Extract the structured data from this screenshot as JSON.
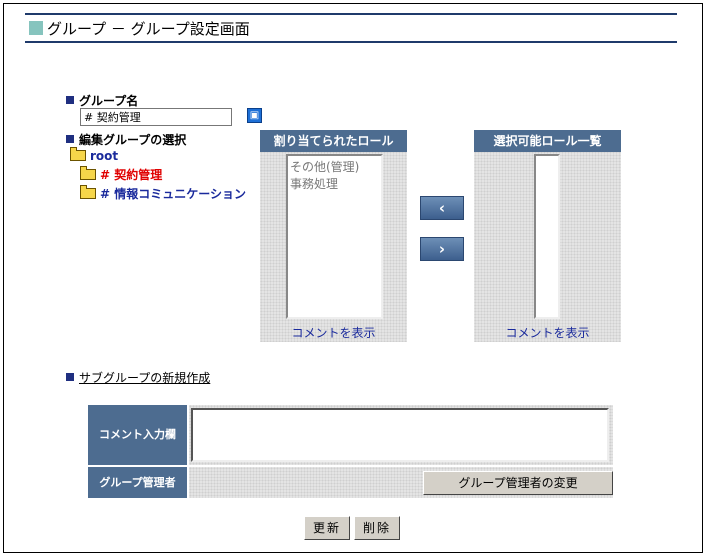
{
  "header": {
    "title": "グループ － グループ設定画面"
  },
  "group_name": {
    "label": "グループ名",
    "value": "# 契約管理"
  },
  "group_select": {
    "label": "編集グループの選択",
    "tree": [
      {
        "label": "root",
        "color": "#1a2a9c"
      },
      {
        "label": "# 契約管理",
        "color": "#e00000"
      },
      {
        "label": "# 情報コミュニケーション",
        "color": "#1a2a9c"
      }
    ]
  },
  "assigned_roles": {
    "header": "割り当てられたロール",
    "items": [
      "その他(管理)",
      "事務処理"
    ],
    "comment_link": "コメントを表示"
  },
  "available_roles": {
    "header": "選択可能ロール一覧",
    "items": [],
    "comment_link": "コメントを表示"
  },
  "transfer": {
    "left_icon": "chevron-left-icon",
    "right_icon": "chevron-right-icon",
    "left_glyph": "‹",
    "right_glyph": "›"
  },
  "new_subgroup": {
    "label": "サブグループの新規作成"
  },
  "comment": {
    "label": "コメント入力欄",
    "value": ""
  },
  "group_admin": {
    "label": "グループ管理者",
    "change_button": "グループ管理者の変更"
  },
  "actions": {
    "update": "更新",
    "delete": "削除"
  },
  "colors": {
    "accent": "#4d6c90",
    "title_rule": "#1f3a6b",
    "link": "#1a2a9c",
    "selected": "#e00000"
  }
}
